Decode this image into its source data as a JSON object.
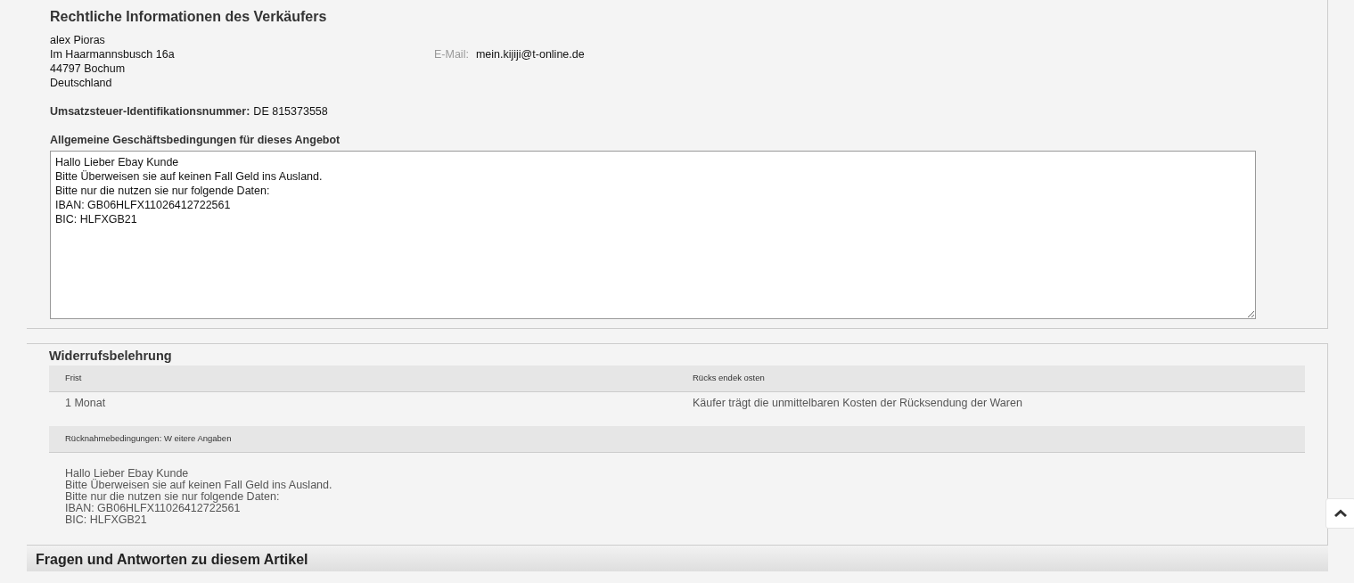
{
  "seller_legal": {
    "title": "Rechtliche Informationen des Verkäufers",
    "address": [
      "alex Pioras",
      "Im Haarmannsbusch 16a",
      "44797 Bochum",
      "Deutschland"
    ],
    "email_label": "E-Mail:",
    "email": "mein.kijiji@t-online.de",
    "vat_label": "Umsatzsteuer-Identifikationsnummer:",
    "vat_value": "DE 815373558",
    "terms_title": "Allgemeine Geschäftsbedingungen für dieses Angebot",
    "terms_text": [
      "Hallo Lieber Ebay Kunde",
      "Bitte Überweisen sie auf keinen Fall Geld ins Ausland.",
      "Bitte nur die nutzen sie nur folgende Daten:",
      "IBAN: GB06HLFX11026412722561",
      "BIC: HLFXGB21"
    ]
  },
  "withdrawal": {
    "title": "Widerrufsbelehrung",
    "columns": [
      "Frist",
      "Rücks endek osten"
    ],
    "row": [
      "1 Monat",
      "Käufer trägt die unmittelbaren Kosten der Rücksendung der Waren"
    ],
    "details_header": "Rücknahmebedingungen: W eitere Angaben",
    "details_text": [
      "Hallo Lieber Ebay Kunde",
      "Bitte Überweisen sie auf keinen Fall Geld ins Ausland.",
      "Bitte nur die nutzen sie nur folgende Daten:",
      "IBAN: GB06HLFX11026412722561",
      "BIC: HLFXGB21"
    ]
  },
  "qa_section": {
    "title": "Fragen und Antworten zu diesem Artikel"
  }
}
